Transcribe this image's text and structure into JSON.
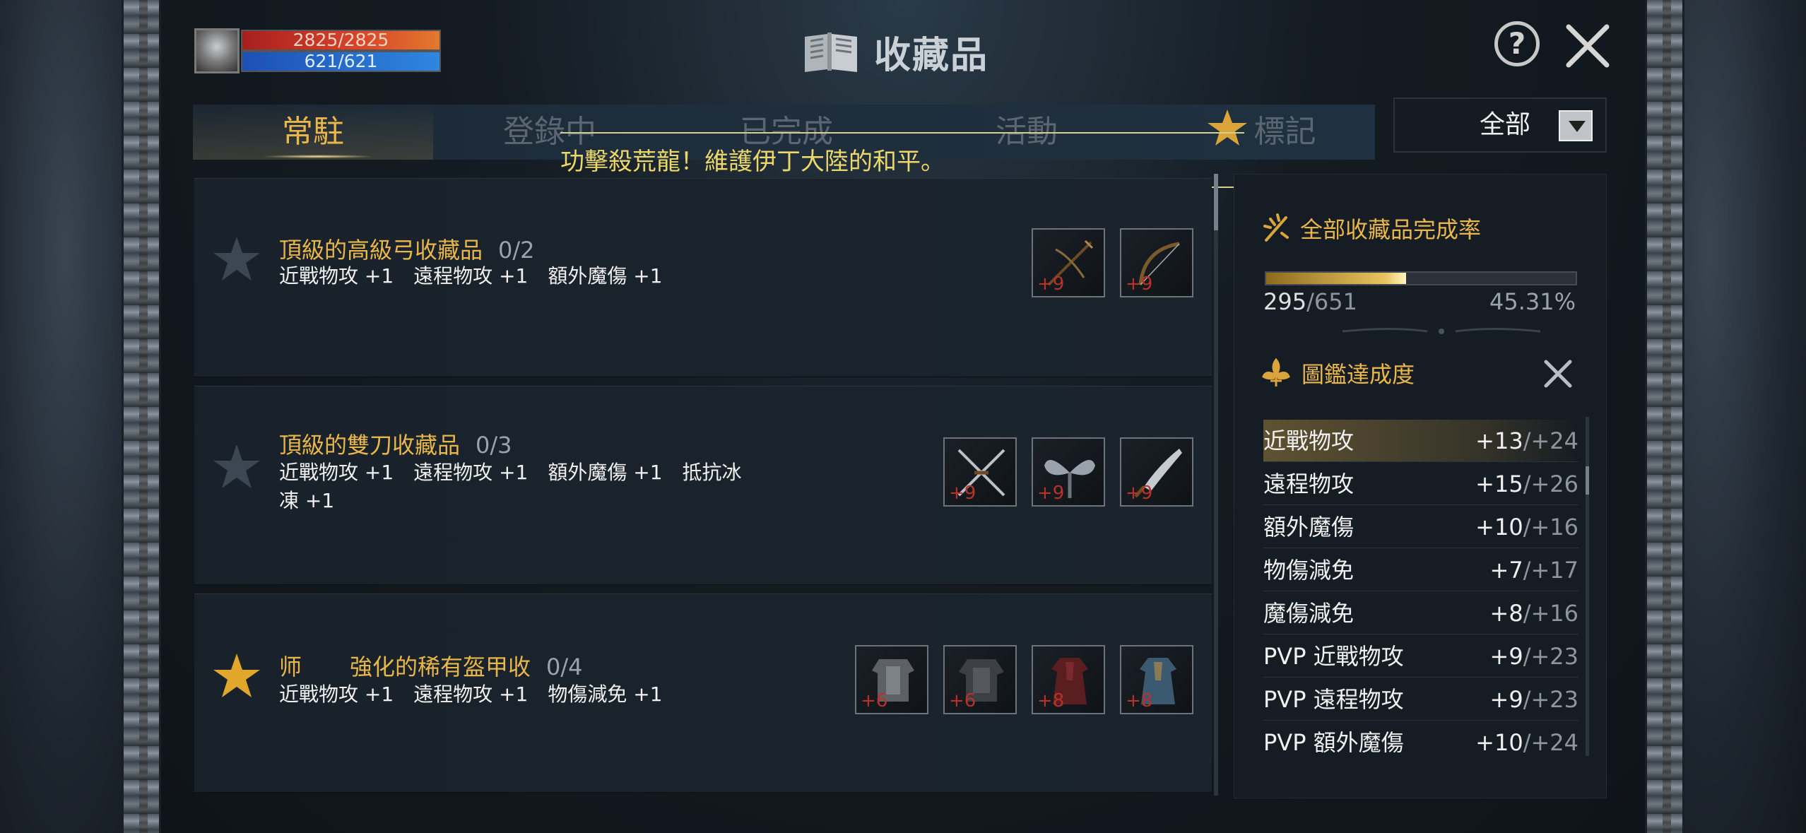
{
  "player": {
    "hp": "2825/2825",
    "mp": "621/621"
  },
  "header": {
    "title": "收藏品",
    "help_label": "?"
  },
  "tabs": [
    {
      "label": "常駐",
      "active": true
    },
    {
      "label": "登錄中",
      "active": false
    },
    {
      "label": "已完成",
      "active": false
    },
    {
      "label": "活動",
      "active": false
    },
    {
      "label": "標記",
      "active": false
    }
  ],
  "filter": {
    "selected": "全部"
  },
  "marquee": {
    "text": "功擊殺荒龍！維護伊丁大陸的和平。"
  },
  "collections": [
    {
      "title": "頂級的高級弓收藏品",
      "count": "0/2",
      "stats": "近戰物攻 +1　遠程物攻 +1　額外魔傷 +1",
      "starred": false,
      "items": [
        {
          "icon": "crossbow-icon",
          "level": "+9"
        },
        {
          "icon": "bow-icon",
          "level": "+9"
        }
      ]
    },
    {
      "title": "頂級的雙刀收藏品",
      "count": "0/3",
      "stats_line1": "近戰物攻 +1　遠程物攻 +1　額外魔傷 +1　抵抗冰",
      "stats_line2": "凍 +1",
      "starred": false,
      "items": [
        {
          "icon": "crossed-swords-icon",
          "level": "+9"
        },
        {
          "icon": "winged-blade-icon",
          "level": "+9"
        },
        {
          "icon": "scimitar-icon",
          "level": "+9"
        }
      ]
    },
    {
      "title_prefix": "师",
      "title": "強化的稀有盔甲收",
      "count": "0/4",
      "stats": "近戰物攻 +1　遠程物攻 +1　物傷減免 +1",
      "starred": true,
      "items": [
        {
          "icon": "plate-armor-icon",
          "level": "+6"
        },
        {
          "icon": "dark-armor-icon",
          "level": "+6"
        },
        {
          "icon": "red-robe-icon",
          "level": "+8"
        },
        {
          "icon": "blue-robe-icon",
          "level": "+8"
        }
      ]
    }
  ],
  "completion": {
    "title": "全部收藏品完成率",
    "current": "295",
    "total": "/651",
    "percent": "45.31%",
    "progress": 0.4531
  },
  "codex": {
    "title": "圖鑑達成度",
    "rows": [
      {
        "name": "近戰物攻",
        "value": "+13",
        "max": "/+24"
      },
      {
        "name": "遠程物攻",
        "value": "+15",
        "max": "/+26"
      },
      {
        "name": "額外魔傷",
        "value": "+10",
        "max": "/+16"
      },
      {
        "name": "物傷減免",
        "value": "+7",
        "max": "/+17"
      },
      {
        "name": "魔傷減免",
        "value": "+8",
        "max": "/+16"
      },
      {
        "name": "PVP 近戰物攻",
        "value": "+9",
        "max": "/+23"
      },
      {
        "name": "PVP 遠程物攻",
        "value": "+9",
        "max": "/+23"
      },
      {
        "name": "PVP 額外魔傷",
        "value": "+10",
        "max": "/+24"
      }
    ]
  },
  "colors": {
    "accent_gold": "#e9b64b",
    "bonus_red": "#b83229"
  }
}
